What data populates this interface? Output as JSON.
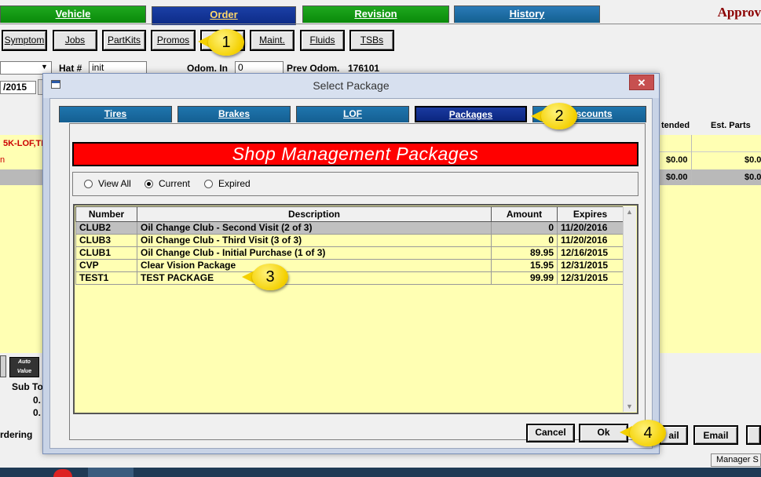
{
  "app": {
    "main_tabs": [
      {
        "label": "Vehicle"
      },
      {
        "label": "Order"
      },
      {
        "label": "Revision"
      },
      {
        "label": "History"
      }
    ],
    "approval_text": "Approv",
    "toolbar": [
      "Symptom",
      "Jobs",
      "PartKits",
      "Promos",
      "Maint.",
      "Fluids",
      "TSBs"
    ],
    "hat_label": "Hat #",
    "hat_value": "init",
    "odom_in_label": "Odom. In",
    "odom_in_value": "0",
    "prev_odom_label": "Prev Odom.",
    "prev_odom_value": "176101",
    "date_fragment": "/2015",
    "job_fragment": "5K-LOF,TI",
    "row_fragment": "n",
    "col_extended": "tended",
    "col_est_parts": "Est. Parts",
    "money_a": "$0.00",
    "money_b": "$0.0",
    "sub_total_label": "Sub To",
    "sub_val_1": "0.",
    "sub_val_2": "0.",
    "ordering_label": "rdering",
    "email_label": "Email",
    "ail_label": "ail",
    "manager_label": "Manager S",
    "autovalue_label": "Auto Value"
  },
  "dialog": {
    "title": "Select Package",
    "close_symbol": "✕",
    "tabs": [
      {
        "label": "Tires"
      },
      {
        "label": "Brakes"
      },
      {
        "label": "LOF"
      },
      {
        "label": "Packages"
      },
      {
        "label": "Discounts"
      }
    ],
    "banner": "Shop Management Packages",
    "filters": [
      {
        "label": "View All",
        "checked": false
      },
      {
        "label": "Current",
        "checked": true
      },
      {
        "label": "Expired",
        "checked": false
      }
    ],
    "columns": [
      "Number",
      "Description",
      "Amount",
      "Expires"
    ],
    "rows": [
      {
        "number": "CLUB2",
        "description": "Oil Change Club - Second Visit (2 of 3)",
        "amount": "0",
        "expires": "11/20/2016"
      },
      {
        "number": "CLUB3",
        "description": "Oil Change Club - Third Visit (3 of 3)",
        "amount": "0",
        "expires": "11/20/2016"
      },
      {
        "number": "CLUB1",
        "description": "Oil Change Club - Initial Purchase (1 of 3)",
        "amount": "89.95",
        "expires": "12/16/2015"
      },
      {
        "number": "CVP",
        "description": "Clear Vision Package",
        "amount": "15.95",
        "expires": "12/31/2015"
      },
      {
        "number": "TEST1",
        "description": "TEST PACKAGE",
        "amount": "99.99",
        "expires": "12/31/2015"
      }
    ],
    "cancel_label": "Cancel",
    "ok_label": "Ok"
  },
  "callouts": [
    "1",
    "2",
    "3",
    "4"
  ],
  "colors": {
    "banner_red": "#ff0000",
    "grid_yellow": "#ffffb3",
    "tab_blue": "#145f92",
    "tab_active_blue": "#0b267f",
    "tab_green": "#0a8a0a",
    "callout_yellow": "#f4d000"
  }
}
